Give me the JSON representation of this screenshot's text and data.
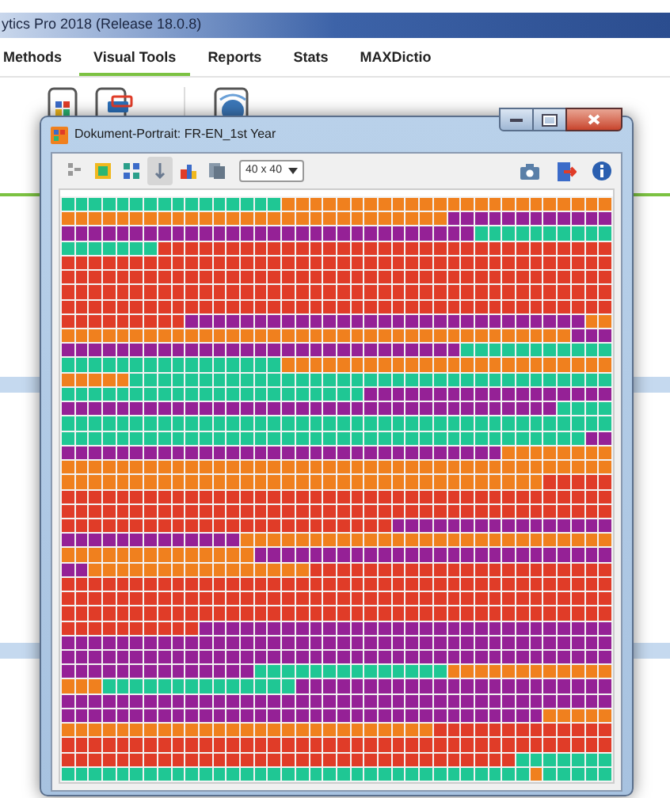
{
  "app": {
    "title": "ytics Pro 2018  (Release 18.0.8)"
  },
  "tabs": [
    {
      "label": "Methods",
      "selected": false
    },
    {
      "label": "Visual Tools",
      "selected": true
    },
    {
      "label": "Reports",
      "selected": false
    },
    {
      "label": "Stats",
      "selected": false
    },
    {
      "label": "MAXDictio",
      "selected": false
    }
  ],
  "portrait_window": {
    "title": "Dokument-Portrait: FR-EN_1st Year",
    "tools": [
      {
        "selected": false
      },
      {
        "selected": false
      },
      {
        "selected": false
      },
      {
        "selected": true
      },
      {
        "selected": false
      },
      {
        "selected": false
      }
    ],
    "grid_size": "40 x 40"
  }
}
